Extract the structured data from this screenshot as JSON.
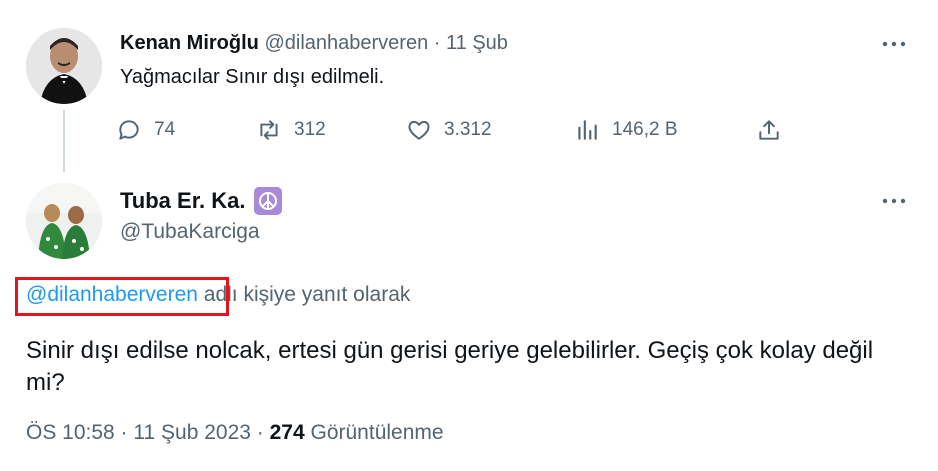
{
  "parent_tweet": {
    "author_name": "Kenan Miroğlu",
    "author_handle": "@dilanhaberveren",
    "separator": "·",
    "date": "11 Şub",
    "text": "Yağmacılar Sınır dışı edilmeli.",
    "actions": {
      "replies": "74",
      "retweets": "312",
      "likes": "3.312",
      "views": "146,2 B"
    }
  },
  "reply_tweet": {
    "author_name": "Tuba Er. Ka.",
    "author_badge_icon": "peace-symbol-icon",
    "author_handle": "@TubaKarciga",
    "replying_to_mention": "@dilanhaberveren",
    "replying_to_suffix": " adlı kişiye yanıt olarak",
    "text": "Sinir dışı edilse nolcak, ertesi gün gerisi geriye gelebilirler. Geçiş çok kolay değil mi?",
    "timestamp": "ÖS 10:58 · 11 Şub 2023 · ",
    "view_count": "274",
    "views_label": " Görüntülenme"
  },
  "colors": {
    "accent": "#1d9bf0",
    "muted_text": "#536471",
    "highlight_box": "#e0161e",
    "peace_badge": "#a98ad8"
  }
}
